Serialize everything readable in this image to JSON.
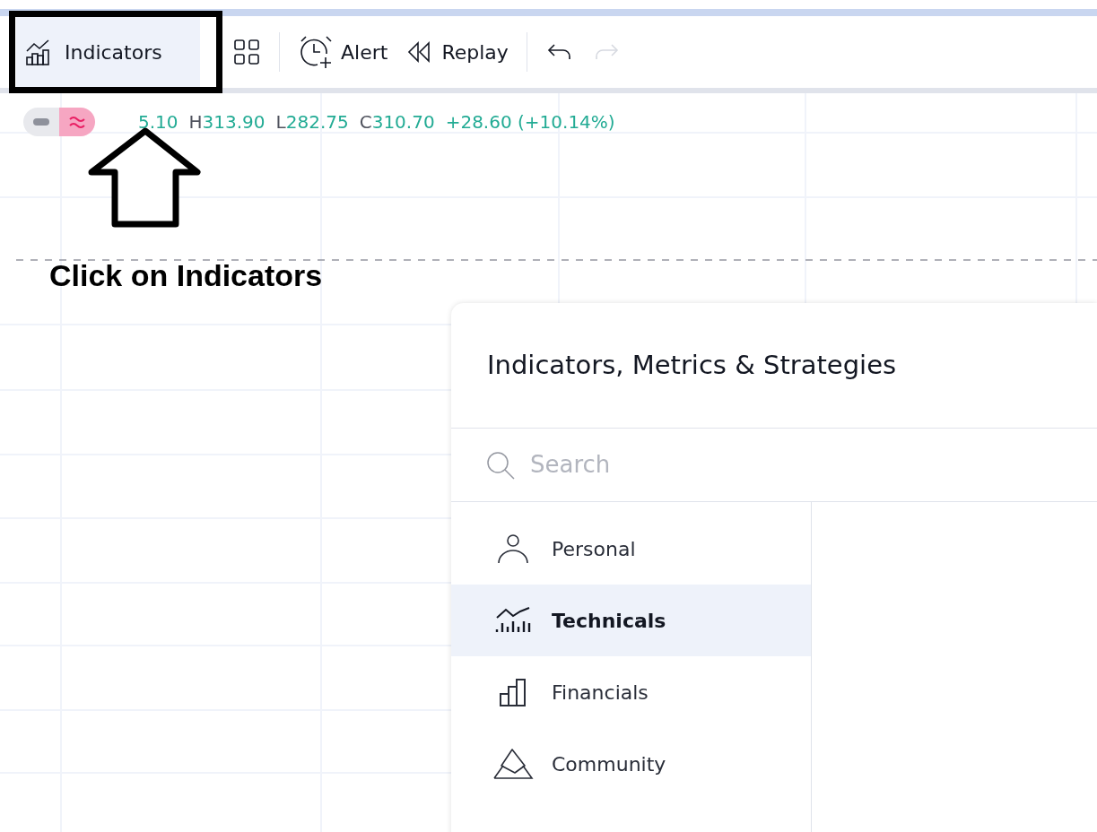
{
  "toolbar": {
    "buttons": [
      {
        "kind": "indicators",
        "label": "Indicators",
        "highlighted": true,
        "disabled": false
      },
      {
        "kind": "templates",
        "highlighted": false,
        "disabled": false
      },
      {
        "kind": "alert",
        "label": "Alert",
        "highlighted": false,
        "disabled": false
      },
      {
        "kind": "replay",
        "label": "Replay",
        "highlighted": false,
        "disabled": false
      },
      {
        "kind": "undo",
        "highlighted": false,
        "disabled": false
      },
      {
        "kind": "redo",
        "highlighted": false,
        "disabled": true
      }
    ]
  },
  "legend": {
    "values": [
      {
        "value": "5.10"
      },
      {
        "label": "H",
        "value": "313.90"
      },
      {
        "label": "L",
        "value": "282.75"
      },
      {
        "label": "C",
        "value": "310.70"
      },
      {
        "value": "+28.60 (+10.14%)"
      }
    ]
  },
  "annotation": {
    "text": "Click on Indicators"
  },
  "dialog": {
    "title": "Indicators, Metrics & Strategies",
    "search": {
      "placeholder": "Search"
    },
    "categories": [
      {
        "kind": "personal",
        "label": "Personal",
        "selected": false
      },
      {
        "kind": "technicals",
        "label": "Technicals",
        "selected": true
      },
      {
        "kind": "financials",
        "label": "Financials",
        "selected": false
      },
      {
        "kind": "community",
        "label": "Community",
        "selected": false
      }
    ]
  }
}
